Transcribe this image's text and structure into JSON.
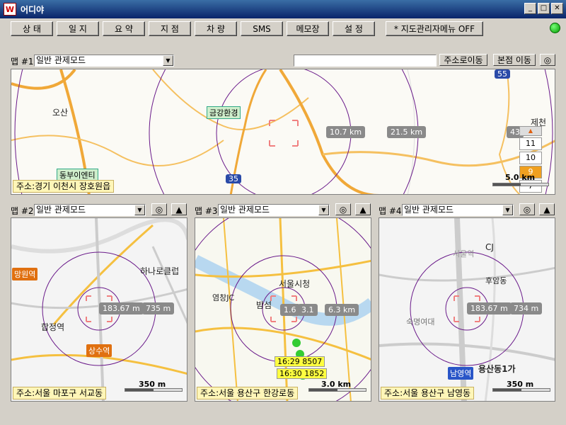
{
  "window": {
    "title": "어디야",
    "icon": "app-logo-icon"
  },
  "window_controls": {
    "minimize": "_",
    "maximize": "□",
    "close": "✕"
  },
  "toolbar": {
    "buttons": [
      "상 태",
      "일 지",
      "요 약",
      "지 점",
      "차 량",
      "SMS",
      "메모장",
      "설 정",
      "* 지도관리자메뉴 OFF"
    ]
  },
  "status": {
    "color": "#22aa22"
  },
  "map1": {
    "label": "맵 #1",
    "mode": "일반 관제모드",
    "search_value": "",
    "btn_move_addr": "주소로이동",
    "btn_move_hq": "본점 이동",
    "address": "주소:경기 이천시 장호원읍",
    "dist1": "10.7 km",
    "dist2": "21.5 km",
    "dist3": "43",
    "poi_gumgang": "금강환경",
    "poi_dongbu": "동부이엔티",
    "town_osan": "오산",
    "town_jecheon": "제천",
    "highway_55": "55",
    "highway_35": "35",
    "scale": "5.0 km",
    "zoom_levels": [
      "11",
      "10",
      "9",
      "7"
    ],
    "zoom_active": "9"
  },
  "map2": {
    "label": "맵 #2",
    "mode": "일반 관제모드",
    "address": "주소:서울 마포구 서교동",
    "dist1": "183.67 m",
    "dist2": "735 m",
    "poi_mangwon": "망원역",
    "poi_sangsu": "상수역",
    "poi_hapjeong": "합정역",
    "poi_hana": "하나로클럽",
    "scale": "350 m"
  },
  "map3": {
    "label": "맵 #3",
    "mode": "일반 관제모드",
    "address": "주소:서울 용산구 한강로동",
    "dist1": "1.6",
    "dist2": "3.1",
    "dist3": "6.3 km",
    "poi_cityhall": "서울시청",
    "poi_yeomchang": "염창JC",
    "poi_bampo": "밤섬",
    "vehicle1": "16:29 8507",
    "vehicle2": "16:30 1852",
    "scale": "3.0 km"
  },
  "map4": {
    "label": "맵 #4",
    "mode": "일반 관제모드",
    "address": "주소:서울 용산구 남영동",
    "dist1": "183.67 m",
    "dist2": "734 m",
    "poi_namyeong": "남영역",
    "poi_seoul": "서울역",
    "poi_huam": "후암동",
    "poi_cj": "CJ",
    "poi_sookmyung": "숙명여대",
    "poi_yongsan1": "용산동1가",
    "scale": "350 m"
  }
}
